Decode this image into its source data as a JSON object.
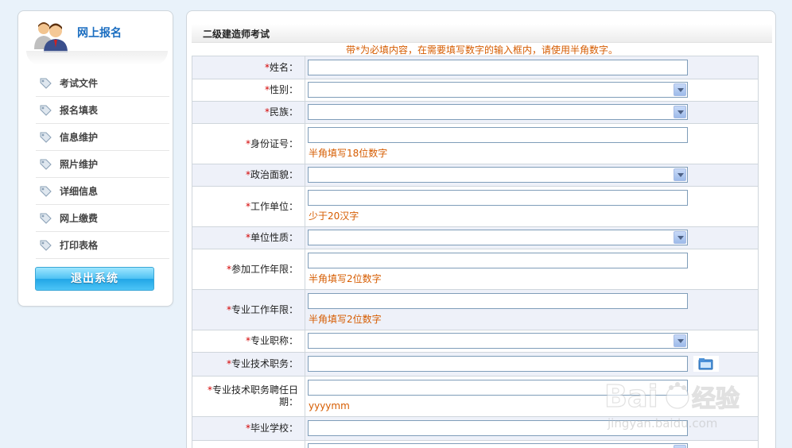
{
  "sidebar": {
    "title": "网上报名",
    "items": [
      {
        "label": "考试文件"
      },
      {
        "label": "报名填表"
      },
      {
        "label": "信息维护"
      },
      {
        "label": "照片维护"
      },
      {
        "label": "详细信息"
      },
      {
        "label": "网上缴费"
      },
      {
        "label": "打印表格"
      }
    ],
    "logout_label": "退出系统"
  },
  "main": {
    "title": "二级建造师考试",
    "notice": "带*为必填内容，在需要填写数字的输入框内，请使用半角数字。",
    "fields": [
      {
        "label": "姓名：",
        "type": "text",
        "value": "",
        "hint": ""
      },
      {
        "label": "性别：",
        "type": "select",
        "value": "",
        "hint": ""
      },
      {
        "label": "民族：",
        "type": "select",
        "value": "",
        "hint": ""
      },
      {
        "label": "身份证号：",
        "type": "text",
        "value": "",
        "hint": "半角填写18位数字"
      },
      {
        "label": "政治面貌：",
        "type": "select",
        "value": "",
        "hint": ""
      },
      {
        "label": "工作单位：",
        "type": "text",
        "value": "",
        "hint": "少于20汉字"
      },
      {
        "label": "单位性质：",
        "type": "select",
        "value": "",
        "hint": ""
      },
      {
        "label": "参加工作年限：",
        "type": "text",
        "value": "",
        "hint": "半角填写2位数字"
      },
      {
        "label": "专业工作年限：",
        "type": "text",
        "value": "",
        "hint": "半角填写2位数字"
      },
      {
        "label": "专业职称：",
        "type": "select",
        "value": "",
        "hint": ""
      },
      {
        "label": "专业技术职务：",
        "type": "text",
        "value": "",
        "hint": ""
      },
      {
        "label": "专业技术职务聘任日期：",
        "type": "text",
        "value": "",
        "hint": "yyyymm"
      },
      {
        "label": "毕业学校：",
        "type": "text",
        "value": "",
        "hint": ""
      }
    ]
  },
  "watermark": {
    "text": "Baidu 经验",
    "sub": "jingyan.baidu.com"
  },
  "colors": {
    "accent": "#1a6dc0",
    "hint": "#d65c00",
    "required": "#d40000",
    "row_alt": "#eef1f9",
    "border": "#cfd6dc"
  }
}
